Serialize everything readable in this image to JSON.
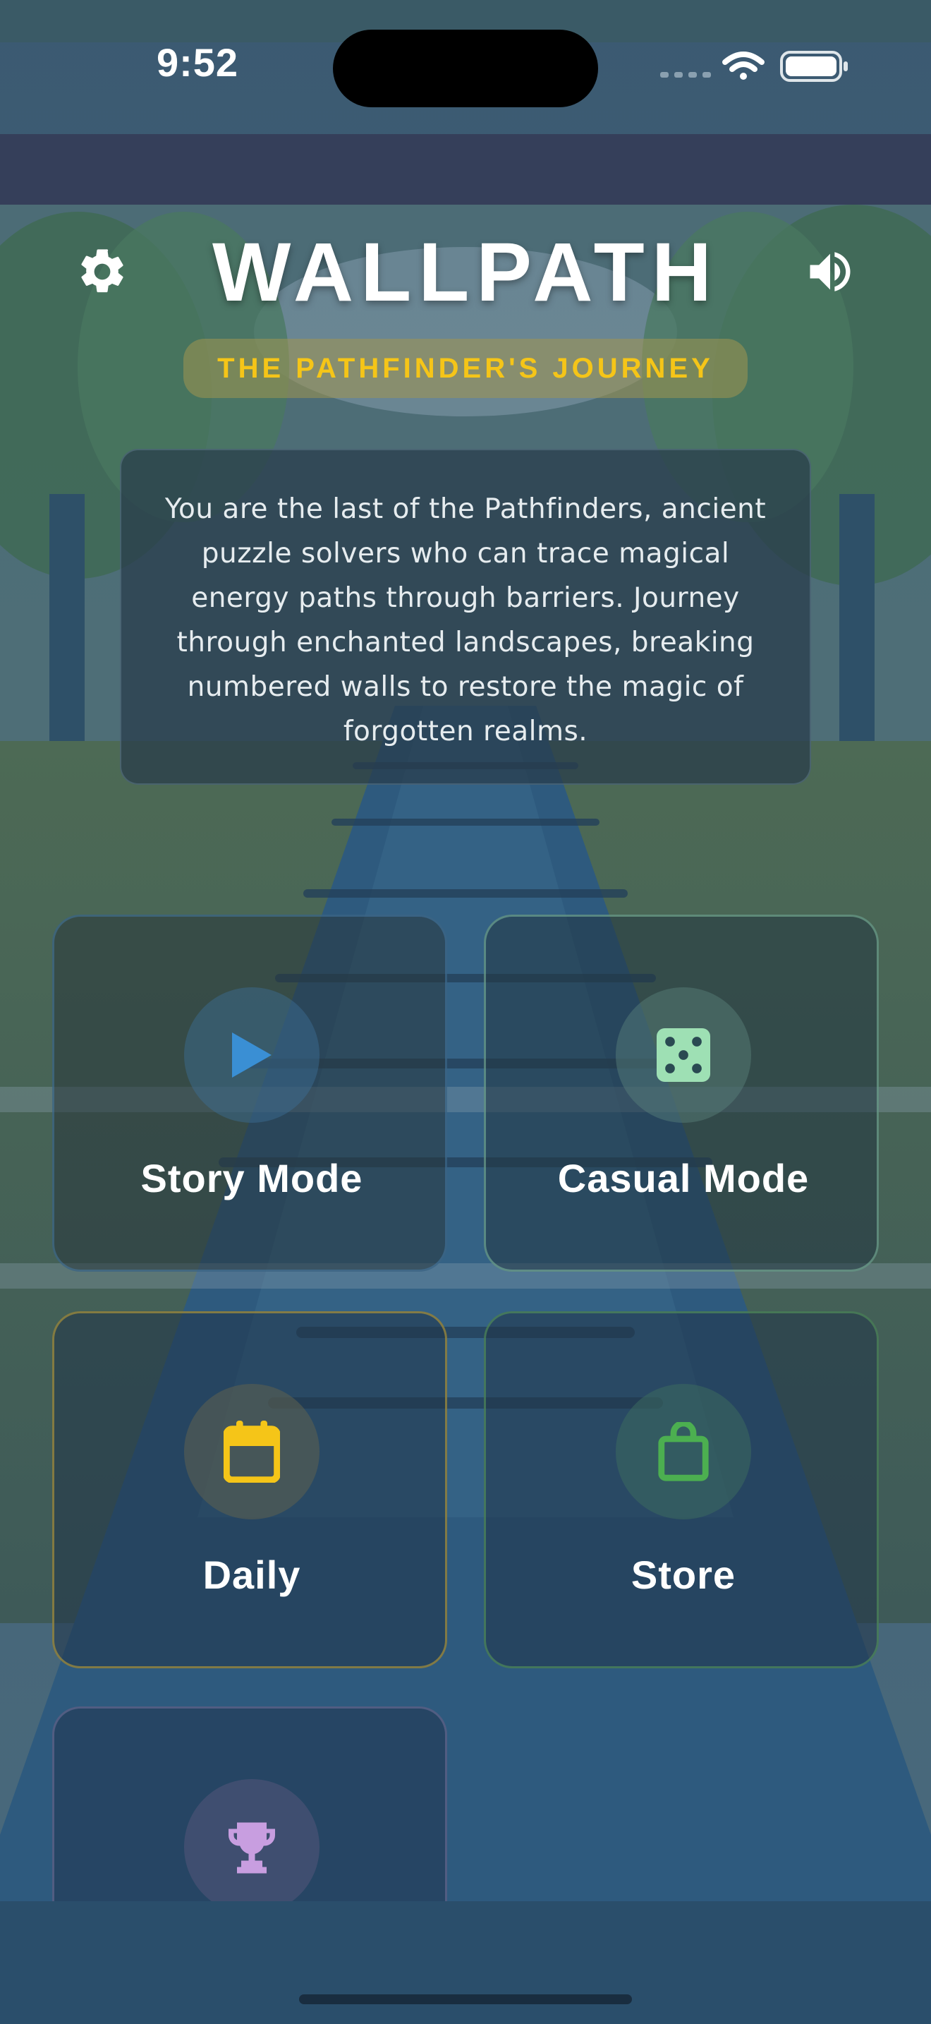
{
  "status_bar": {
    "time": "9:52"
  },
  "header": {
    "title": "WALLPATH",
    "subtitle": "THE PATHFINDER'S JOURNEY",
    "settings_icon": "gear-icon",
    "sound_icon": "speaker-icon"
  },
  "lore": {
    "text": "You are the last of the Pathfinders, ancient puzzle solvers who can trace magical energy paths through barriers. Journey through enchanted landscapes, breaking numbered walls to restore the magic of forgotten realms."
  },
  "modes": [
    {
      "label": "Story Mode",
      "icon": "play-icon",
      "color": "#3a8fd4"
    },
    {
      "label": "Casual Mode",
      "icon": "dice-icon",
      "color": "#9ee0b4"
    },
    {
      "label": "Daily",
      "icon": "calendar-icon",
      "color": "#f5c518"
    },
    {
      "label": "Store",
      "icon": "shopping-bag-icon",
      "color": "#4caf50"
    },
    {
      "label": "",
      "icon": "trophy-icon",
      "color": "#c89ee0"
    }
  ],
  "colors": {
    "accent_gold": "#f5c518",
    "background": "#2a4a62"
  }
}
